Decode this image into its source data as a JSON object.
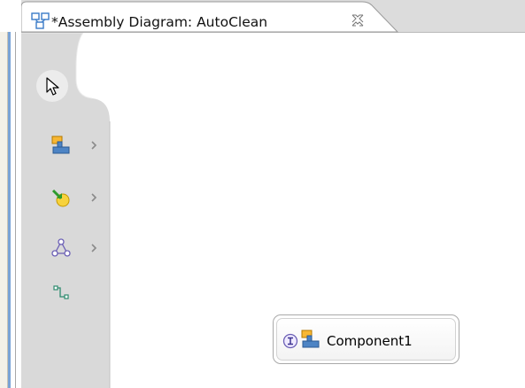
{
  "tab": {
    "title": "*Assembly Diagram: AutoClean",
    "icon": "assembly-diagram-icon",
    "close_icon": "close-tab-icon"
  },
  "palette": {
    "tools": [
      {
        "name": "select-tool",
        "icon": "arrow-pointer-icon",
        "has_drawer": false
      },
      {
        "name": "component-tool",
        "icon": "component-icon",
        "has_drawer": true
      },
      {
        "name": "import-tool",
        "icon": "import-icon",
        "has_drawer": true
      },
      {
        "name": "shape-tool",
        "icon": "network-icon",
        "has_drawer": true
      },
      {
        "name": "wire-tool",
        "icon": "wire-icon",
        "has_drawer": false
      }
    ]
  },
  "diagram": {
    "components": [
      {
        "label": "Component1",
        "icon": "component-icon",
        "interface_icon": "interface-icon"
      }
    ]
  },
  "colors": {
    "palette_bg": "#d9d9d9",
    "tab_bar": "#dcdcdc",
    "component_orange": "#f7b733",
    "component_blue": "#4d84c4",
    "interface_purple": "#6b5fb5"
  }
}
